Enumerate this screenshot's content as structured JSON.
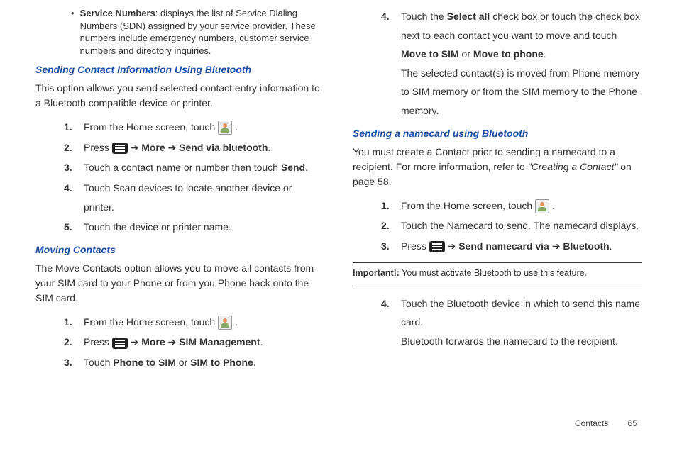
{
  "left": {
    "bullet": {
      "label": "Service Numbers",
      "text": ": displays the list of Service Dialing Numbers (SDN) assigned by your service provider. These numbers include emergency numbers, customer service numbers and directory inquiries."
    },
    "h1": "Sending Contact Information Using Bluetooth",
    "p1": "This option allows you send selected contact entry information to a Bluetooth compatible device or printer.",
    "steps1": [
      {
        "n": "1.",
        "pre": "From the Home screen, touch ",
        "icon": "contact",
        "post": " ."
      },
      {
        "n": "2.",
        "pre": "Press ",
        "icon": "menu",
        "post_html": " <span class='arrow'>➔</span> <strong>More</strong> <span class='arrow'>➔</span> <strong>Send via bluetooth</strong>."
      },
      {
        "n": "3.",
        "html": "Touch a contact name or number then touch <strong>Send</strong>."
      },
      {
        "n": "4.",
        "text": "Touch Scan devices to locate another device or printer."
      },
      {
        "n": "5.",
        "text": "Touch the device or printer name."
      }
    ],
    "h2": "Moving Contacts",
    "p2": "The Move Contacts option allows you to move all contacts from your SIM card to your Phone or from you Phone back onto the SIM card.",
    "steps2": [
      {
        "n": "1.",
        "pre": "From the Home screen, touch ",
        "icon": "contact",
        "post": " ."
      },
      {
        "n": "2.",
        "pre": "Press ",
        "icon": "menu",
        "post_html": " <span class='arrow'>➔</span> <strong>More</strong> <span class='arrow'>➔</span> <strong>SIM Management</strong>."
      },
      {
        "n": "3.",
        "html": "Touch <strong>Phone to SIM</strong> or <strong>SIM to Phone</strong>."
      }
    ]
  },
  "right": {
    "step4": {
      "n": "4.",
      "html": "Touch the <strong>Select all</strong> check box or touch the check box next to each contact you want to move and touch <strong>Move to SIM</strong> or <strong>Move to phone</strong>.",
      "after": "The selected contact(s) is moved from Phone memory to SIM memory or from the SIM memory to the Phone memory."
    },
    "h3": "Sending a namecard using Bluetooth",
    "p3_pre": "You must create a Contact prior to sending a namecard to a recipient. For more information, refer to ",
    "p3_ref": "\"Creating a Contact\"",
    "p3_post": " on page 58.",
    "steps3": [
      {
        "n": "1.",
        "pre": "From the Home screen, touch ",
        "icon": "contact",
        "post": " ."
      },
      {
        "n": "2.",
        "text": "Touch the Namecard to send. The namecard displays."
      },
      {
        "n": "3.",
        "pre": "Press ",
        "icon": "menu",
        "post_html": " <span class='arrow'>➔</span> <strong>Send namecard via</strong> <span class='arrow'>➔</span> <strong>Bluetooth</strong>."
      }
    ],
    "note_label": "Important!:",
    "note_text": " You must activate Bluetooth to use this feature.",
    "steps4": [
      {
        "n": "4.",
        "text": "Touch the Bluetooth device in which to send this name card.",
        "after": "Bluetooth forwards the namecard to the recipient."
      }
    ]
  },
  "footer": {
    "section": "Contacts",
    "page": "65"
  }
}
